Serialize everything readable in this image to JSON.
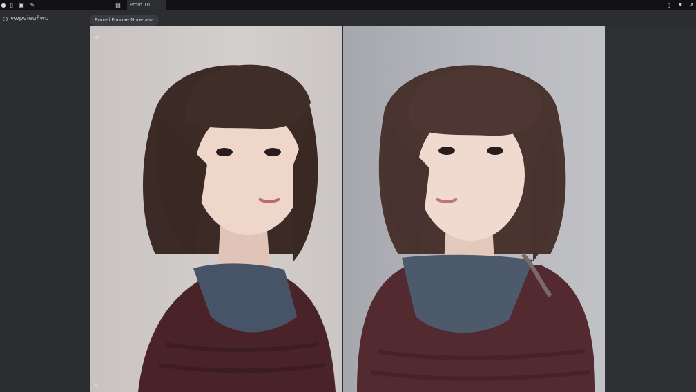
{
  "window": {
    "tabs": [
      {
        "label": ""
      },
      {
        "label": "Prom 10"
      }
    ],
    "icons_left": [
      "rec-icon",
      "doc-icon",
      "media-icon",
      "pen-icon"
    ],
    "icons_right": [
      "window-icon",
      "flag-icon",
      "pin-icon"
    ]
  },
  "sidebar": {
    "title": "vwpvieuFwo"
  },
  "toolbar": {
    "breadcrumb": "Bmnei  Fuonae  Nnoe aaa"
  },
  "viewer": {
    "panels": [
      {
        "name": "left-image",
        "background": "#cfcac8",
        "sweater": "#4a2329",
        "collar": "#475468",
        "hair": "#3b2a25"
      },
      {
        "name": "right-image",
        "background": "#b5b6bb",
        "sweater": "#532a30",
        "collar": "#4d5a6c",
        "hair": "#4a3430"
      }
    ],
    "back_label": "<",
    "resize_label": "↘"
  },
  "colors": {
    "app_bg": "#2c2d30",
    "topbar_bg": "#121214",
    "pill_bg": "#3a3b40"
  }
}
